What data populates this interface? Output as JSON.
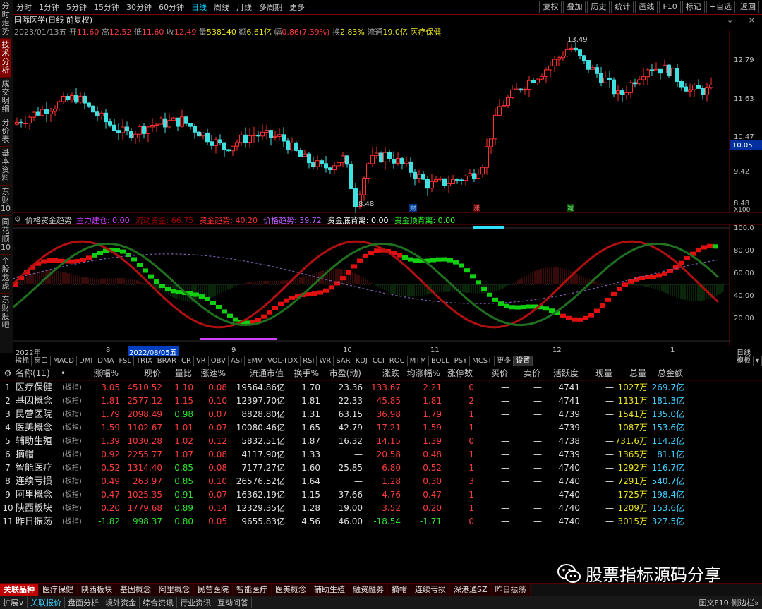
{
  "left_tabs": [
    "分时走势",
    "技术分析",
    "成交明细",
    "分价表",
    "基本资料",
    "东财10",
    "同花顺10",
    "个股龙虎",
    "东财股吧"
  ],
  "left_tab_active": 1,
  "toolbar": {
    "periods": [
      "分时",
      "1分钟",
      "5分钟",
      "15分钟",
      "30分钟",
      "60分钟",
      "日线",
      "周线",
      "月线",
      "多周期",
      "更多"
    ],
    "active_period": 6,
    "right_buttons": [
      "复权",
      "叠加",
      "历史",
      "统计",
      "画线",
      "F10",
      "标记",
      "+自选",
      "返回"
    ]
  },
  "kline_info": {
    "title": "国际医学(日线 前复权)",
    "date": "2023/01/13五",
    "open_label": "开",
    "open": "11.60",
    "high_label": "高",
    "high": "12.52",
    "low_label": "低",
    "low": "11.60",
    "close_label": "收",
    "close": "12.49",
    "vol_label": "量",
    "vol": "538140",
    "amt_label": "额",
    "amt": "6.61亿",
    "chg_label": "幅",
    "chg": "0.86(7.39%)",
    "turn_label": "换",
    "turn": "2.83%",
    "float_label": "流通",
    "float": "19.0亿",
    "sector": "医疗保健"
  },
  "kline_axis": {
    "labels": [
      "12.79",
      "11.63",
      "10.47",
      "9.42",
      "8.48"
    ],
    "current_price": "10.05",
    "scale": "X100"
  },
  "kline_annotations": {
    "max": "13.49",
    "min": "8.48",
    "marks": [
      "财",
      "涨",
      "减"
    ]
  },
  "indicator": {
    "name": "价格资金趋势",
    "items": [
      {
        "label": "主力建仓:",
        "value": "0.00",
        "color": "#d040ff"
      },
      {
        "label": "流动资金:",
        "value": "66.75",
        "color": "#a00000"
      },
      {
        "label": "资金趋势:",
        "value": "40.20",
        "color": "#ff3030"
      },
      {
        "label": "价格趋势:",
        "value": "39.72",
        "color": "#c060ff"
      },
      {
        "label": "资金底背离:",
        "value": "0.00",
        "color": "#ffffff"
      },
      {
        "label": "资金顶背离:",
        "value": "0.00",
        "color": "#30ff30"
      }
    ],
    "axis": [
      "100.0",
      "80.00",
      "60.00",
      "40.00",
      "20.00"
    ]
  },
  "date_axis": {
    "start": "2022年",
    "highlight": "2022/08/05五",
    "months": [
      "8",
      "9",
      "10",
      "11",
      "12",
      "1"
    ],
    "right": "日线"
  },
  "indicator_tabs": [
    "指标",
    "窗口",
    "MACD",
    "DMI",
    "DMA",
    "FSL",
    "TRIX",
    "BRAR",
    "CR",
    "VR",
    "OBV",
    "ASI",
    "EMV",
    "VOL-TDX",
    "RSI",
    "WR",
    "SAR",
    "KDJ",
    "CCI",
    "ROC",
    "MTM",
    "BOLL",
    "PSY",
    "MCST",
    "更多",
    "设置"
  ],
  "indicator_tab_right": "模板",
  "table": {
    "headers": [
      "",
      "名称(11)",
      "•",
      "涨幅%",
      "现价",
      "量比",
      "涨速%",
      "流通市值",
      "换手%",
      "市盈(动)",
      "涨跌",
      "均涨幅%",
      "涨停数",
      "买价",
      "卖价",
      "活跃度",
      "现量",
      "总量",
      "总金额"
    ],
    "rows": [
      [
        "1",
        "医疗保健",
        "(板指)",
        "3.05",
        "4510.52",
        "1.10",
        "0.08",
        "19564.86亿",
        "1.70",
        "23.36",
        "133.67",
        "2.21",
        "0",
        "—",
        "—",
        "4741",
        "—",
        "1027万",
        "269.7亿"
      ],
      [
        "2",
        "基因概念",
        "(板指)",
        "1.81",
        "2577.12",
        "1.15",
        "0.10",
        "12397.70亿",
        "1.81",
        "22.33",
        "45.85",
        "1.81",
        "2",
        "—",
        "—",
        "4741",
        "—",
        "1131万",
        "181.3亿"
      ],
      [
        "3",
        "民营医院",
        "(板指)",
        "1.79",
        "2098.49",
        "0.98",
        "0.07",
        "8828.80亿",
        "1.31",
        "63.15",
        "36.98",
        "1.79",
        "1",
        "—",
        "—",
        "4739",
        "—",
        "1541万",
        "135.0亿"
      ],
      [
        "4",
        "医美概念",
        "(板指)",
        "1.59",
        "1102.67",
        "1.01",
        "0.07",
        "10080.46亿",
        "1.65",
        "42.79",
        "17.21",
        "1.59",
        "1",
        "—",
        "—",
        "4739",
        "—",
        "1087万",
        "153.6亿"
      ],
      [
        "5",
        "辅助生殖",
        "(板指)",
        "1.39",
        "1030.28",
        "1.02",
        "0.12",
        "5832.51亿",
        "1.87",
        "16.32",
        "14.15",
        "1.39",
        "0",
        "—",
        "—",
        "4738",
        "—",
        "731.6万",
        "114.2亿"
      ],
      [
        "6",
        "摘帽",
        "(板指)",
        "0.92",
        "2255.77",
        "1.07",
        "0.08",
        "4117.90亿",
        "1.33",
        "—",
        "20.58",
        "0.48",
        "1",
        "—",
        "—",
        "4739",
        "—",
        "1365万",
        "81.1亿"
      ],
      [
        "7",
        "智能医疗",
        "(板指)",
        "0.52",
        "1314.40",
        "0.85",
        "0.08",
        "7177.27亿",
        "1.60",
        "25.85",
        "6.80",
        "0.52",
        "1",
        "—",
        "—",
        "4740",
        "—",
        "1292万",
        "116.7亿"
      ],
      [
        "8",
        "连续亏损",
        "(板指)",
        "0.49",
        "263.97",
        "0.85",
        "0.10",
        "26576.52亿",
        "1.64",
        "—",
        "1.28",
        "0.30",
        "3",
        "—",
        "—",
        "4740",
        "—",
        "7291万",
        "540.7亿"
      ],
      [
        "9",
        "阿里概念",
        "(板指)",
        "0.47",
        "1025.35",
        "0.91",
        "0.07",
        "16362.19亿",
        "1.15",
        "37.66",
        "4.76",
        "0.47",
        "1",
        "—",
        "—",
        "4740",
        "—",
        "1725万",
        "198.4亿"
      ],
      [
        "10",
        "陕西板块",
        "(板指)",
        "0.20",
        "1779.68",
        "0.89",
        "0.14",
        "12329.35亿",
        "1.28",
        "19.00",
        "3.52",
        "0.20",
        "1",
        "—",
        "—",
        "4740",
        "—",
        "1209万",
        "153.6亿"
      ],
      [
        "11",
        "昨日振荡",
        "(板指)",
        "-1.82",
        "998.37",
        "0.80",
        "0.05",
        "9655.83亿",
        "4.56",
        "46.00",
        "-18.54",
        "-1.71",
        "0",
        "—",
        "—",
        "4740",
        "—",
        "3015万",
        "327.5亿"
      ]
    ]
  },
  "sectors": [
    "关联品种",
    "医疗保健",
    "陕西板块",
    "基因概念",
    "阿里概念",
    "民营医院",
    "智能医疗",
    "医美概念",
    "辅助生殖",
    "融资融券",
    "摘帽",
    "连续亏损",
    "深港通SZ",
    "昨日振荡"
  ],
  "status_bar": [
    "扩展∨",
    "关联报价",
    "盘面分析",
    "境外资金",
    "综合资讯",
    "行业资讯",
    "互动问答"
  ],
  "status_right": "图文F10 侧边栏»",
  "watermark": "股票指标源码分享"
}
